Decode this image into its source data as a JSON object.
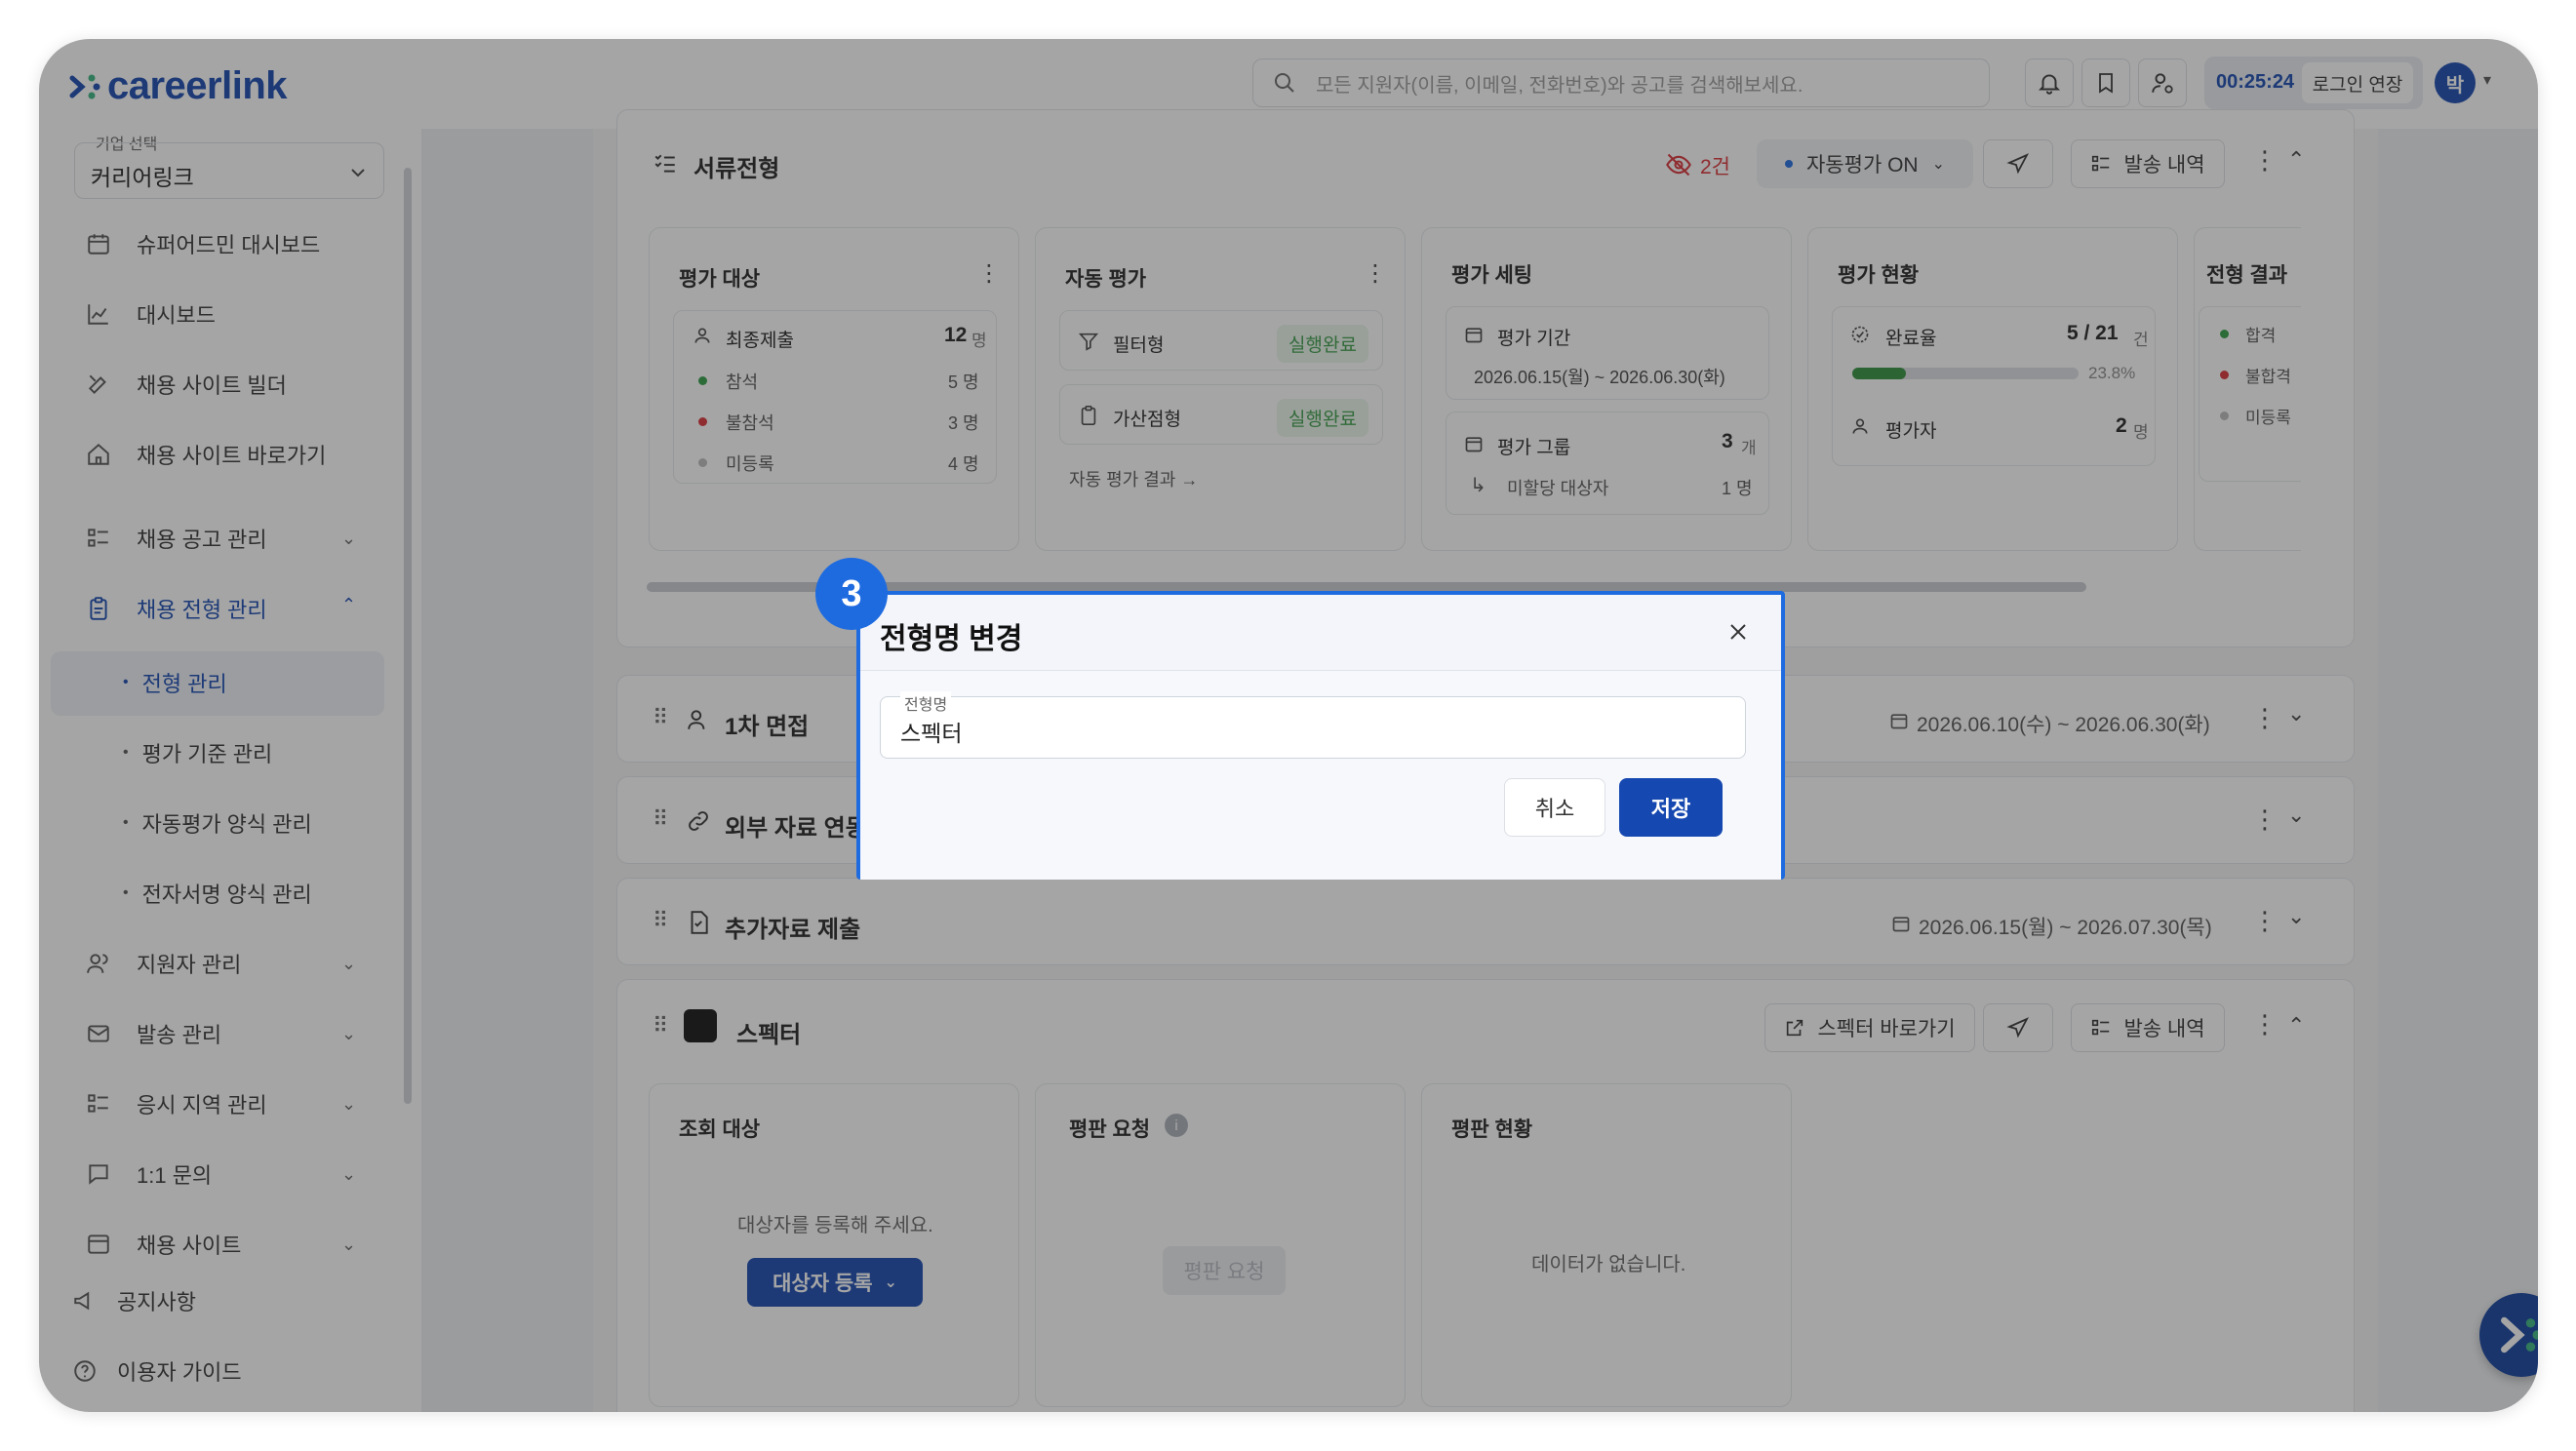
{
  "app": {
    "logo": "careerlink",
    "search_placeholder": "모든 지원자(이름, 이메일, 전화번호)와 공고를 검색해보세요.",
    "timer": "00:25:24",
    "extend_label": "로그인 연장",
    "avatar": "박"
  },
  "sidebar": {
    "company_label": "기업 선택",
    "company_value": "커리어링크",
    "items": [
      {
        "label": "슈퍼어드민 대시보드"
      },
      {
        "label": "대시보드"
      },
      {
        "label": "채용 사이트 빌더"
      },
      {
        "label": "채용 사이트 바로가기"
      },
      {
        "label": "채용 공고 관리"
      },
      {
        "label": "채용 전형 관리"
      },
      {
        "label": "지원자 관리"
      },
      {
        "label": "발송 관리"
      },
      {
        "label": "응시 지역 관리"
      },
      {
        "label": "1:1 문의"
      },
      {
        "label": "채용 사이트"
      }
    ],
    "sub_items": [
      "전형 관리",
      "평가 기준 관리",
      "자동평가 양식 관리",
      "전자서명 양식 관리"
    ],
    "footer": [
      "공지사항",
      "이용자 가이드"
    ]
  },
  "doc_stage": {
    "title": "서류전형",
    "hidden_count": "2건",
    "auto_eval": "자동평가 ON",
    "send_history": "발송 내역",
    "target": {
      "title": "평가 대상",
      "rows": [
        {
          "label": "최종제출",
          "value": "12",
          "unit": "명"
        },
        {
          "label": "참석",
          "value": "5 명"
        },
        {
          "label": "불참석",
          "value": "3 명"
        },
        {
          "label": "미등록",
          "value": "4 명"
        }
      ]
    },
    "auto": {
      "title": "자동 평가",
      "rows": [
        {
          "label": "필터형",
          "status": "실행완료"
        },
        {
          "label": "가산점형",
          "status": "실행완료"
        }
      ],
      "link": "자동 평가 결과 →"
    },
    "setting": {
      "title": "평가 세팅",
      "period_label": "평가 기간",
      "period": "2026.06.15(월) ~ 2026.06.30(화)",
      "group_label": "평가 그룹",
      "group_value": "3",
      "group_unit": "개",
      "unassigned_label": "미할당 대상자",
      "unassigned_value": "1 명"
    },
    "status": {
      "title": "평가 현황",
      "rate_label": "완료율",
      "rate_value": "5 / 21",
      "rate_unit": "건",
      "progress": 0.238,
      "progress_text": "23.8%",
      "evaluator_label": "평가자",
      "evaluator_value": "2",
      "evaluator_unit": "명"
    },
    "result": {
      "title": "전형 결과",
      "items": [
        "합격",
        "불합격",
        "미등록"
      ]
    }
  },
  "stages": [
    {
      "name": "1차 면접",
      "date": "2026.06.10(수) ~ 2026.06.30(화)"
    },
    {
      "name": "외부 자료 연동",
      "date": ""
    },
    {
      "name": "추가자료 제출",
      "date": "2026.06.15(월) ~ 2026.07.30(목)"
    }
  ],
  "specter": {
    "title": "스펙터",
    "link_btn": "스펙터 바로가기",
    "send_history": "발송 내역",
    "lookup": {
      "title": "조회 대상",
      "empty": "대상자를 등록해 주세요.",
      "register": "대상자 등록"
    },
    "request": {
      "title": "평판 요청",
      "button": "평판 요청"
    },
    "status": {
      "title": "평판 현황",
      "empty": "데이터가 없습니다."
    }
  },
  "modal": {
    "step": "3",
    "title": "전형명 변경",
    "field_label": "전형명",
    "field_value": "스펙터",
    "cancel": "취소",
    "save": "저장"
  },
  "colors": {
    "primary": "#1548b0",
    "accent_blue": "#1e6be0",
    "success": "#2f8f3c",
    "danger": "#d93036"
  }
}
